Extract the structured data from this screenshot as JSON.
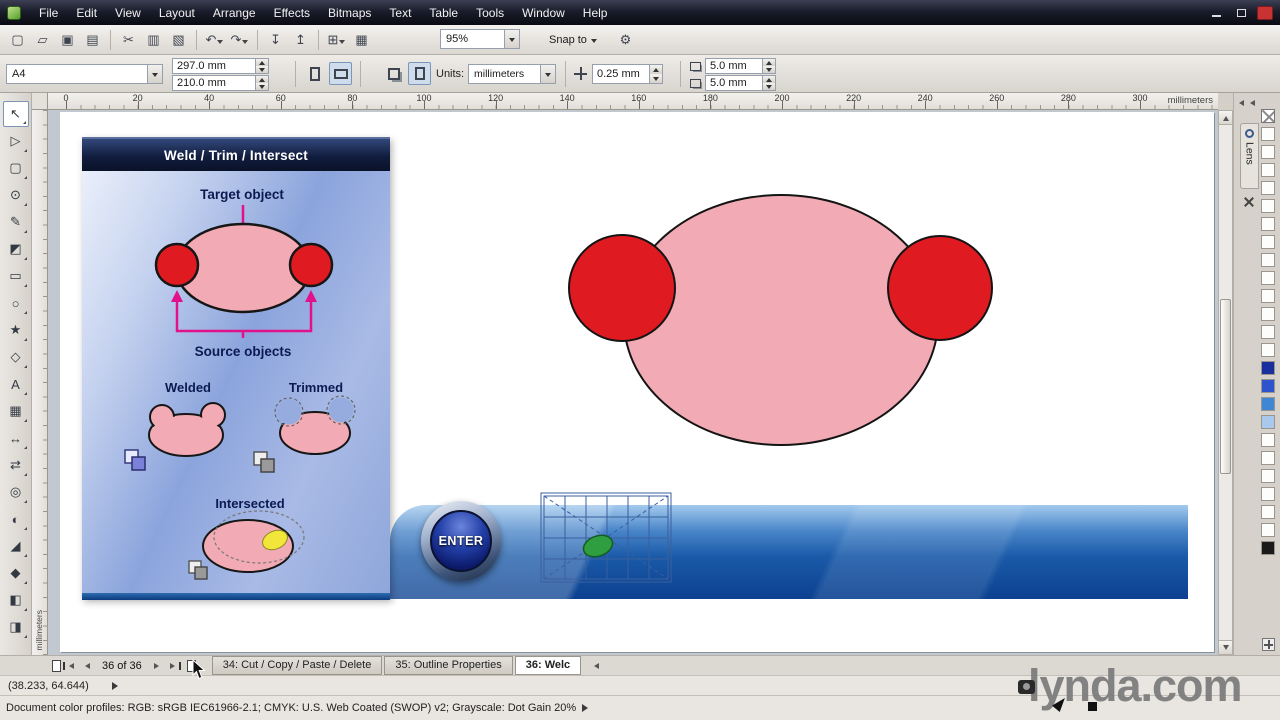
{
  "colors": {
    "pink": "#f2abb4",
    "red": "#df1a21",
    "magenta": "#e0118a",
    "navy": "#0c1a52",
    "yellow": "#f2e63a",
    "green": "#2f9e41"
  },
  "window": {
    "menus": [
      "File",
      "Edit",
      "View",
      "Layout",
      "Arrange",
      "Effects",
      "Bitmaps",
      "Text",
      "Table",
      "Tools",
      "Window",
      "Help"
    ]
  },
  "toolbar": {
    "zoom_value": "95%",
    "snap_label": "Snap to",
    "options_glyph": "⚙",
    "buttons": [
      {
        "name": "new-document",
        "glyph": "▢"
      },
      {
        "name": "open",
        "glyph": "▱"
      },
      {
        "name": "save",
        "glyph": "▣"
      },
      {
        "name": "print",
        "glyph": "▤",
        "sep": true
      },
      {
        "name": "cut",
        "glyph": "✂"
      },
      {
        "name": "copy",
        "glyph": "▥"
      },
      {
        "name": "paste",
        "glyph": "▧",
        "sep": true
      },
      {
        "name": "undo",
        "glyph": "↶",
        "dropdown": true
      },
      {
        "name": "redo",
        "glyph": "↷",
        "dropdown": true,
        "sep": true
      },
      {
        "name": "import",
        "glyph": "↧"
      },
      {
        "name": "export",
        "glyph": "↥",
        "sep": true
      },
      {
        "name": "application-launcher",
        "glyph": "⊞",
        "dropdown": true
      },
      {
        "name": "welcome-screen",
        "glyph": "▦"
      }
    ]
  },
  "property_bar": {
    "preset": "A4",
    "page_width": "297.0 mm",
    "page_height": "210.0 mm",
    "units_label": "Units:",
    "units_value": "millimeters",
    "nudge_value": "0.25 mm",
    "duplicate_x": "5.0 mm",
    "duplicate_y": "5.0 mm"
  },
  "ruler": {
    "h_ticks": [
      "0",
      "20",
      "40",
      "60",
      "80",
      "100",
      "120",
      "140",
      "160",
      "180",
      "200",
      "220",
      "240",
      "260",
      "280",
      "300"
    ],
    "unit_label": "millimeters",
    "v_unit_label": "millimeters"
  },
  "toolbox": {
    "tools": [
      {
        "name": "pick",
        "glyph": "↖"
      },
      {
        "name": "shape",
        "glyph": "▷"
      },
      {
        "name": "crop",
        "glyph": "▢"
      },
      {
        "name": "zoom",
        "glyph": "⊙"
      },
      {
        "name": "freehand",
        "glyph": "✎"
      },
      {
        "name": "smart-fill",
        "glyph": "◩"
      },
      {
        "name": "rectangle",
        "glyph": "▭"
      },
      {
        "name": "ellipse",
        "glyph": "○"
      },
      {
        "name": "polygon",
        "glyph": "★"
      },
      {
        "name": "basic-shapes",
        "glyph": "◇"
      },
      {
        "name": "text",
        "glyph": "A"
      },
      {
        "name": "table",
        "glyph": "▦"
      },
      {
        "name": "parallel-dimension",
        "glyph": "↔"
      },
      {
        "name": "connector",
        "glyph": "⇄"
      },
      {
        "name": "blend",
        "glyph": "◎"
      },
      {
        "name": "transparency",
        "glyph": "◐"
      },
      {
        "name": "color-eyedropper",
        "glyph": "◢"
      },
      {
        "name": "outline-pen",
        "glyph": "◆"
      },
      {
        "name": "fill",
        "glyph": "◧"
      },
      {
        "name": "interactive-fill",
        "glyph": "◨"
      }
    ]
  },
  "tutorial": {
    "title": "Weld / Trim / Intersect",
    "target_label": "Target object",
    "source_label": "Source objects",
    "welded_label": "Welded",
    "trimmed_label": "Trimmed",
    "intersected_label": "Intersected"
  },
  "stage": {
    "enter_label": "ENTER"
  },
  "docker": {
    "tab_label": "Lens"
  },
  "palette": {
    "swatches": [
      "#fdfdfc",
      "#fdfdfc",
      "#fdfdfc",
      "#fdfdfc",
      "#fdfdfc",
      "#fdfdfc",
      "#fdfdfc",
      "#fdfdfc",
      "#fdfdfc",
      "#fdfdfc",
      "#fdfdfc",
      "#fdfdfc",
      "#fdfdfc",
      "#1a2f9e",
      "#2d54cc",
      "#3f87d6",
      "#a8c8ec",
      "#fdfdfc",
      "#fdfdfc",
      "#fdfdfc",
      "#fdfdfc",
      "#fdfdfc",
      "#fdfdfc",
      "#1a1a1a"
    ]
  },
  "page_nav": {
    "counter": "36 of 36",
    "tabs": [
      {
        "label": "34: Cut / Copy / Paste / Delete",
        "active": false
      },
      {
        "label": "35: Outline Properties",
        "active": false
      },
      {
        "label": "36: Welc",
        "active": true
      }
    ]
  },
  "status": {
    "coords": "(38.233, 64.644)",
    "profiles": "Document color profiles: RGB: sRGB IEC61966-2.1; CMYK: U.S. Web Coated (SWOP) v2; Grayscale: Dot Gain 20%"
  },
  "watermark": {
    "text": "lynda.com"
  }
}
